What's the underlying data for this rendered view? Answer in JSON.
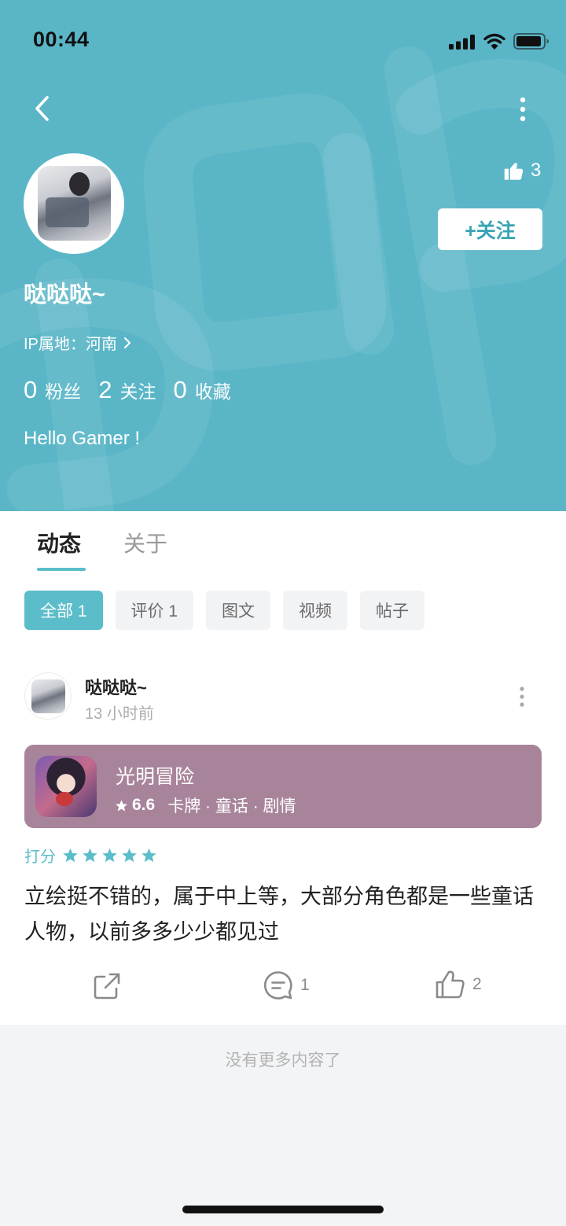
{
  "status_bar": {
    "time": "00:44"
  },
  "colors": {
    "header_bg": "#5ab6c7",
    "accent": "#5bbdca",
    "game_card_bg": "#a8849b",
    "follow_text": "#3aa3b5"
  },
  "icons": {
    "back": "chevron-left-icon",
    "more": "more-vertical-icon",
    "like": "thumbs-up-icon",
    "share": "share-icon",
    "comment": "comment-icon",
    "star": "star-icon"
  },
  "profile": {
    "name": "哒哒哒~",
    "ip_location": "IP属地：河南",
    "likes": "3",
    "follow_label": "+关注",
    "stats": [
      {
        "value": "0",
        "label": "粉丝"
      },
      {
        "value": "2",
        "label": "关注"
      },
      {
        "value": "0",
        "label": "收藏"
      }
    ],
    "bio": "Hello Gamer !"
  },
  "tabs": [
    {
      "label": "动态",
      "active": true
    },
    {
      "label": "关于",
      "active": false
    }
  ],
  "filters": [
    {
      "label": "全部 1",
      "active": true
    },
    {
      "label": "评价 1",
      "active": false
    },
    {
      "label": "图文",
      "active": false
    },
    {
      "label": "视频",
      "active": false
    },
    {
      "label": "帖子",
      "active": false
    }
  ],
  "post": {
    "author": "哒哒哒~",
    "time": "13 小时前",
    "game": {
      "title": "光明冒险",
      "rating": "6.6",
      "tags": "卡牌 · 童话 · 剧情"
    },
    "score": {
      "label": "打分",
      "stars": 5
    },
    "text": "立绘挺不错的，属于中上等，大部分角色都是一些童话人物，以前多多少少都见过",
    "comment_count": "1",
    "like_count": "2"
  },
  "footer": {
    "no_more": "没有更多内容了"
  }
}
